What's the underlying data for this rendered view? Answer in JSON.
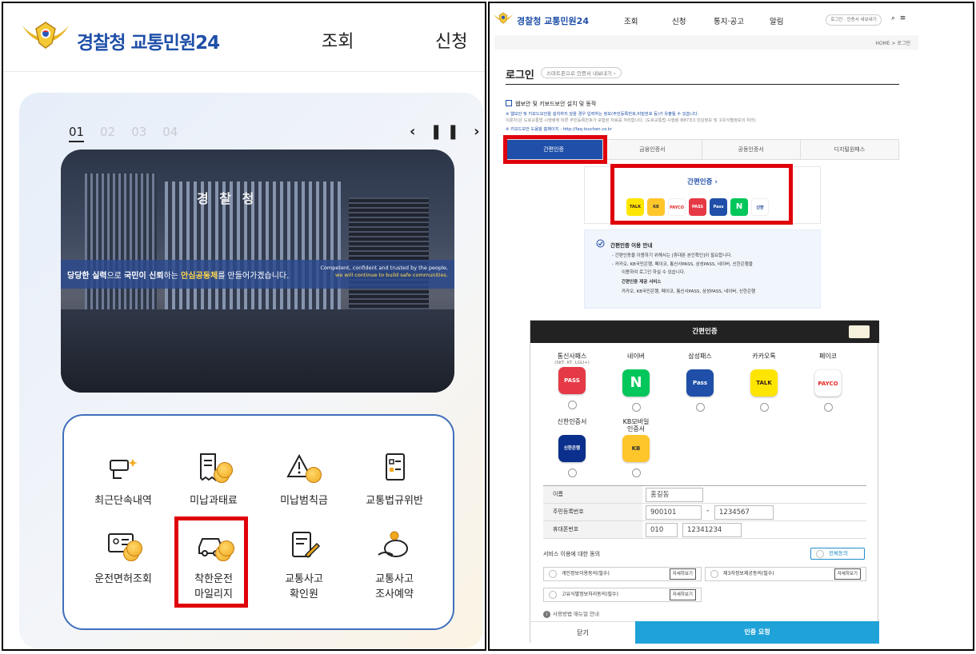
{
  "left": {
    "logo_text": "경찰청 교통민원24",
    "nav": [
      "조회",
      "신청"
    ],
    "pager": {
      "items": [
        "01",
        "02",
        "03",
        "04"
      ],
      "controls": "‹ ❚❚ ›"
    },
    "hero": {
      "building_sign": "경 찰 청",
      "banner_ko_1": "당당한 실력",
      "banner_ko_2": "으로 ",
      "banner_ko_3": "국민이 신뢰",
      "banner_ko_4": "하는 ",
      "banner_ko_5": "안심공동체",
      "banner_ko_6": "를 만들어가겠습니다.",
      "banner_en_1": "Competent, confident and trusted by the people,",
      "banner_en_2": "we will continue to build safe communities."
    },
    "services": [
      {
        "label": "최근단속내역",
        "icon": "camera-icon"
      },
      {
        "label": "미납과태료",
        "icon": "receipt-coin-icon"
      },
      {
        "label": "미납범칙금",
        "icon": "warning-coin-icon"
      },
      {
        "label": "교통법규위반",
        "icon": "checklist-icon"
      },
      {
        "label": "운전면허조회",
        "icon": "license-card-icon"
      },
      {
        "label": "착한운전\n마일리지",
        "icon": "car-coin-icon"
      },
      {
        "label": "교통사고\n확인원",
        "icon": "document-pen-icon"
      },
      {
        "label": "교통사고\n조사예약",
        "icon": "piggy-bank-icon"
      }
    ]
  },
  "right": {
    "logo_text": "경찰청 교통민원24",
    "nav": [
      "조회",
      "신청",
      "통지·공고",
      "알림"
    ],
    "pill": "로그인 · 인증서 내보내기",
    "breadcrumb": "HOME > 로그인",
    "title": "로그인",
    "subtitle": "스마트폰으로 인증서 내보내기 ›",
    "checkbox_label": "웹보안 및 키보드보안 설치 및 동작",
    "note1": "※ 웹보안 및 키보드보안을 설치하지 않을 경우 입력하는 정보(주민등록번호,비밀번호 등)가 유출될 수 있습니다.",
    "note2": "이륜차(은 도로교통법 시행령에 따른 주민등록번호가 포함된 자료를 처리합니다. (도로교통법 시행령 제87조3 민감정보 및 고유식별정보의 처리)",
    "note3": "※ 키보드보안 도움말 홈페이지 : http://faq.touchen.co.kr",
    "tabs": [
      "간편인증",
      "금융인증서",
      "공동인증서",
      "디지털원패스"
    ],
    "easy_title": "간편인증 ›",
    "easy_icons": [
      "TALK",
      "KB",
      "PAYCO",
      "PASS",
      "Pass",
      "N",
      "신한"
    ],
    "guide": {
      "title": "간편인증 이용 안내",
      "line1": "-  간편인증을 이용하기 위해서는 [휴대폰 본인확인]이 필요합니다.",
      "line2": "-  카카오, KB국민은행, 페이코, 통신사PASS, 삼성PASS, 네이버, 신한은행을",
      "line3": "이용하여 로그인 하실 수 있습니다.",
      "line4": "간편인증 제공 서비스",
      "line5": "카카오, KB국민은행, 페이코, 통신사PASS, 삼성PASS, 네이버, 신한은행"
    },
    "modal": {
      "title": "간편인증",
      "providers": [
        {
          "name": "통신사패스",
          "small": "(SKT, KT, LGU+)",
          "logo": "PASS",
          "color": "#e63946"
        },
        {
          "name": "네이버",
          "small": "",
          "logo": "N",
          "color": "#03c75a"
        },
        {
          "name": "삼성패스",
          "small": "",
          "logo": "Pass",
          "color": "#1f4fa8"
        },
        {
          "name": "카카오톡",
          "small": "",
          "logo": "TALK",
          "color": "#fee500"
        },
        {
          "name": "페이코",
          "small": "",
          "logo": "PAYCO",
          "color": "#ffffff"
        },
        {
          "name": "신한인증서",
          "small": "",
          "logo": "신한은행",
          "color": "#0a2f8c"
        },
        {
          "name": "KB모바일\n인증서",
          "small": "",
          "logo": "KB",
          "color": "#ffc62b"
        }
      ],
      "form": {
        "name_label": "이름",
        "name_value": "홍길동",
        "rrn_label": "주민등록번호",
        "rrn_front": "900101",
        "rrn_dash": "-",
        "rrn_back": "1234567",
        "phone_label": "휴대폰번호",
        "phone_prefix": "010",
        "phone_number": "12341234"
      },
      "agree_title": "서비스 이용에 대한 동의",
      "agree_all": "전체동의",
      "consents": [
        "개인정보이용동의(필수)",
        "제3자정보제공동의(필수)",
        "고유식별정보처리동의(필수)"
      ],
      "view_label": "자세히보기",
      "usage": "사용방법 매뉴얼 안내",
      "close": "닫기",
      "request": "인증 요청"
    }
  }
}
